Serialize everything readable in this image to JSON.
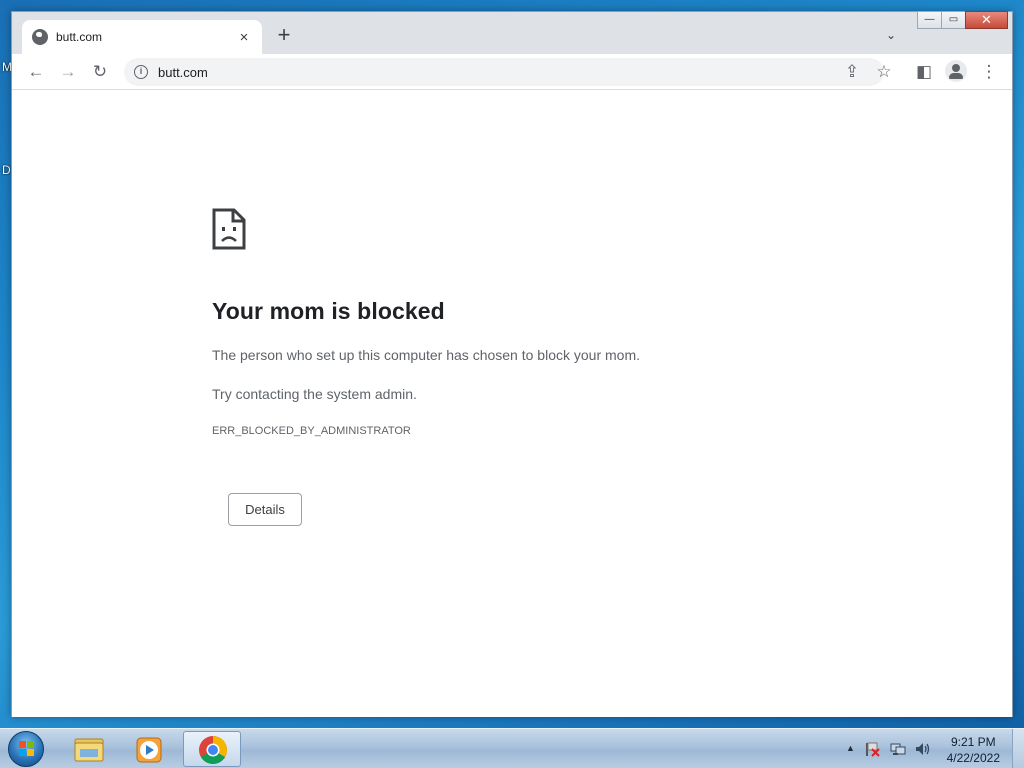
{
  "desktop": {
    "label_1": "M",
    "label_2": "D"
  },
  "browser": {
    "tab": {
      "title": "butt.com",
      "close_glyph": "×"
    },
    "new_tab_glyph": "+",
    "tab_search_glyph": "⌄",
    "window_controls": {
      "minimize": "—",
      "maximize": "▭",
      "close": "✕"
    },
    "toolbar": {
      "back_glyph": "←",
      "forward_glyph": "→",
      "reload_glyph": "↻",
      "url": "butt.com",
      "share_glyph": "⇪",
      "bookmark_glyph": "☆",
      "side_panel_glyph": "◧",
      "menu_glyph": "⋮"
    }
  },
  "error_page": {
    "title": "Your mom is blocked",
    "message": "The person who set up this computer has chosen to block your mom.",
    "suggestion": "Try contacting the system admin.",
    "error_code": "ERR_BLOCKED_BY_ADMINISTRATOR",
    "details_button": "Details"
  },
  "taskbar": {
    "tray_arrow": "▲",
    "clock": {
      "time": "9:21 PM",
      "date": "4/22/2022"
    }
  },
  "colors": {
    "accent": "#1a73e8",
    "text_primary": "#202124",
    "text_secondary": "#5f6368"
  }
}
